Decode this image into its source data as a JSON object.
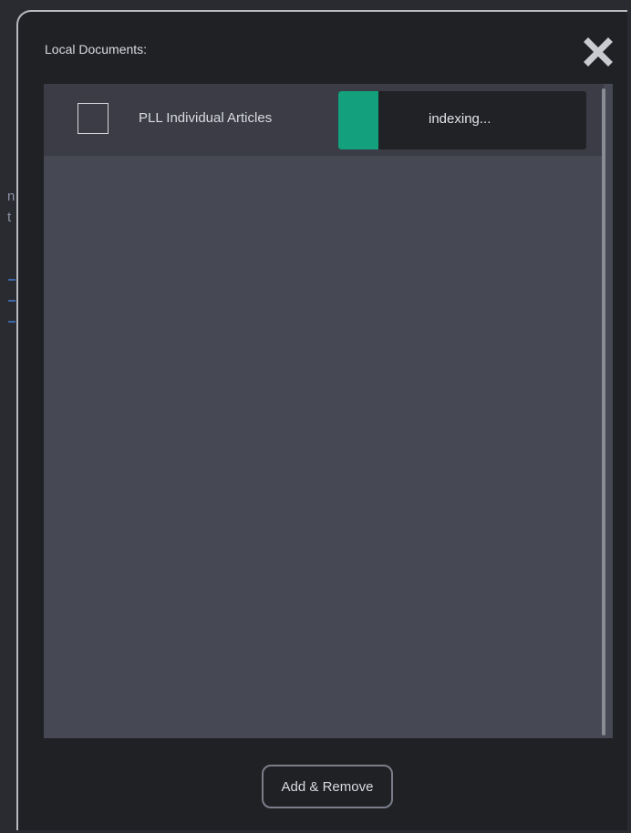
{
  "dialog": {
    "title": "Local Documents:",
    "close_icon": "close-x-icon"
  },
  "documents": [
    {
      "name": "PLL Individual Articles",
      "checked": false,
      "status": "indexing...",
      "progress": 0.16
    }
  ],
  "footer": {
    "button_label": "Add & Remove"
  },
  "colors": {
    "dialog_bg": "#202124",
    "list_bg": "#464853",
    "row_bg": "#3b3c46",
    "progress_fill": "#13a07c",
    "text": "#d9dbe1"
  }
}
